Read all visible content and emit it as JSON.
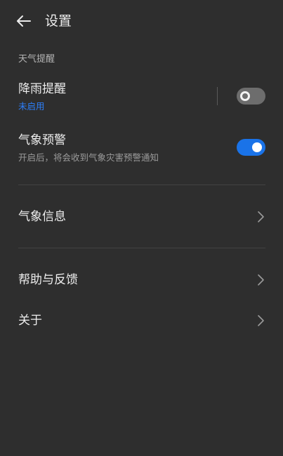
{
  "header": {
    "back_icon": "arrow-left-icon",
    "title": "设置"
  },
  "weather_alert_section": {
    "title": "天气提醒",
    "rain_alert": {
      "title": "降雨提醒",
      "status": "未启用",
      "status_color": "#2d7ff9",
      "enabled": false
    },
    "weather_warning": {
      "title": "气象预警",
      "description": "开启后，将会收到气象灾害预警通知",
      "enabled": true,
      "toggle_color": "#1a73e8"
    }
  },
  "menu": {
    "weather_info": "气象信息",
    "help_feedback": "帮助与反馈",
    "about": "关于",
    "chevron_icon": "chevron-right-icon"
  },
  "colors": {
    "background": "#2e2e2e",
    "accent": "#1a73e8"
  }
}
